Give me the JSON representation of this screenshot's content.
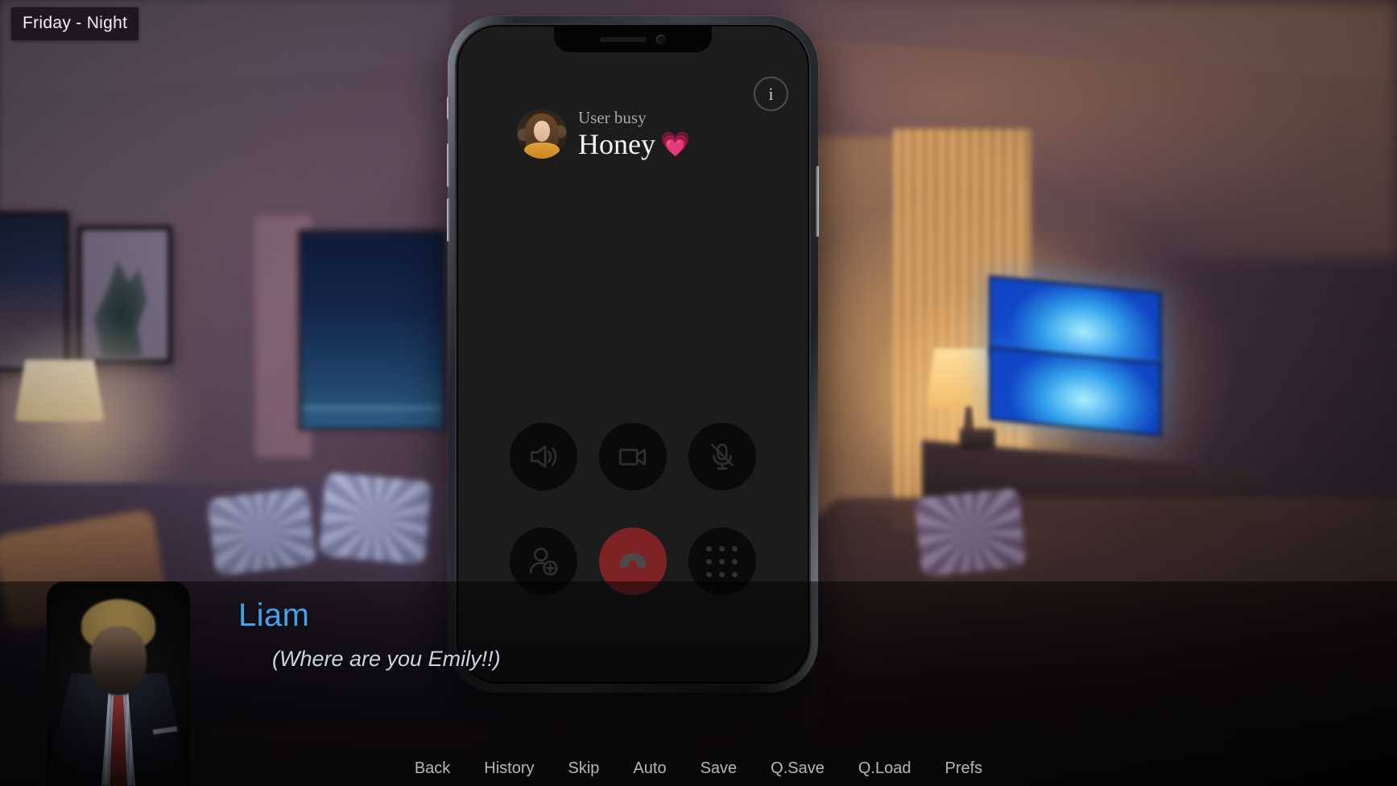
{
  "scene": {
    "time_tag": "Friday - Night"
  },
  "phone": {
    "info_button_label": "i",
    "call": {
      "status": "User busy",
      "contact_name": "Honey",
      "contact_emoji": "💗",
      "avatar_name": "honey-avatar"
    },
    "controls": [
      {
        "id": "speaker",
        "name": "speaker-button",
        "icon": "speaker-icon"
      },
      {
        "id": "video",
        "name": "video-button",
        "icon": "video-camera-icon"
      },
      {
        "id": "mute",
        "name": "mute-button",
        "icon": "microphone-muted-icon"
      },
      {
        "id": "addcall",
        "name": "add-contact-button",
        "icon": "add-person-icon"
      },
      {
        "id": "end",
        "name": "end-call-button",
        "icon": "hang-up-icon"
      },
      {
        "id": "keypad",
        "name": "keypad-button",
        "icon": "keypad-icon"
      }
    ],
    "colors": {
      "end_call": "#7d2326",
      "screen_bg": "#1c1c1c",
      "button_bg": "#0a0a0a"
    }
  },
  "dialogue": {
    "speaker": "Liam",
    "text": "(Where are you Emily!!)",
    "speaker_color": "#3da2f0",
    "text_color": "#c8d6e2",
    "portrait_name": "liam-portrait"
  },
  "quick_menu": {
    "items": [
      {
        "label": "Back",
        "name": "quick-menu-back"
      },
      {
        "label": "History",
        "name": "quick-menu-history"
      },
      {
        "label": "Skip",
        "name": "quick-menu-skip"
      },
      {
        "label": "Auto",
        "name": "quick-menu-auto"
      },
      {
        "label": "Save",
        "name": "quick-menu-save"
      },
      {
        "label": "Q.Save",
        "name": "quick-menu-qsave"
      },
      {
        "label": "Q.Load",
        "name": "quick-menu-qload"
      },
      {
        "label": "Prefs",
        "name": "quick-menu-prefs"
      }
    ]
  }
}
